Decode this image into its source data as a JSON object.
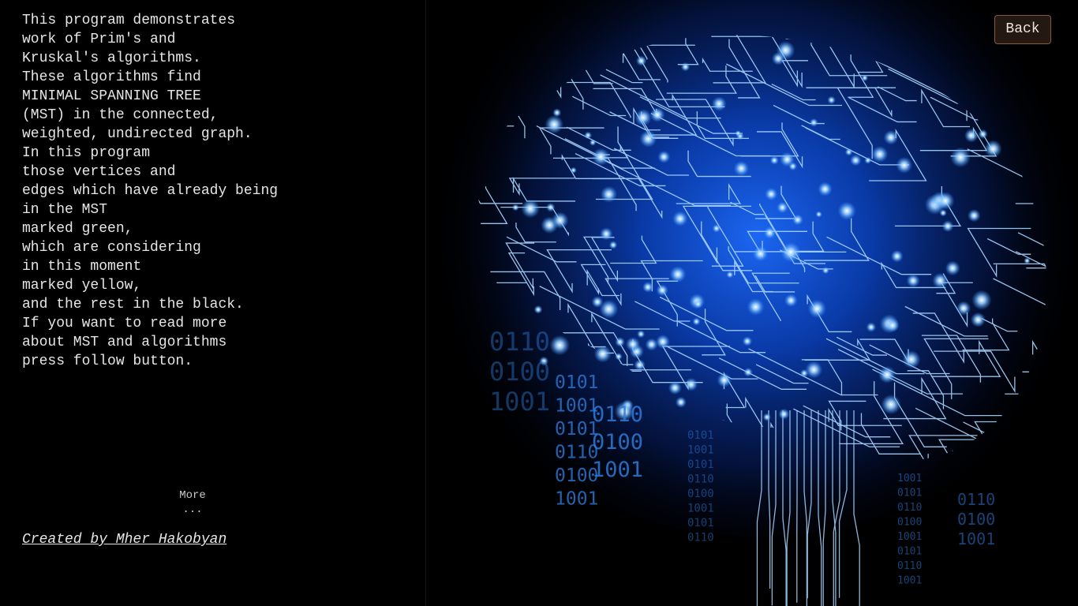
{
  "description": {
    "lines": [
      "This program demonstrates",
      "work of Prim's and",
      "Kruskal's algorithms.",
      "These algorithms find",
      "MINIMAL SPANNING TREE",
      "(MST) in the connected,",
      "weighted, undirected graph.",
      "In this program",
      "those vertices and",
      "edges which have already being",
      "in the MST",
      "marked green,",
      "which are considering",
      "in this moment",
      "marked yellow,",
      "and the rest in the black.",
      "If you want to read more",
      "about MST and algorithms",
      "press follow button."
    ]
  },
  "more": {
    "label": "More",
    "dots": "..."
  },
  "credit": "Created by Mher Hakobyan",
  "back_button": "Back",
  "illustration": {
    "icon": "circuit-brain-illustration",
    "binary_large": [
      "0110",
      "0100",
      "1001"
    ],
    "binary_medium": [
      "0101",
      "1001",
      "0101",
      "0110",
      "0100",
      "1001"
    ],
    "binary_block": [
      "0110",
      "0100",
      "1001"
    ],
    "binary_right": [
      "0110",
      "0100",
      "1001"
    ],
    "binary_small_a": [
      "0101",
      "1001",
      "0101",
      "0110",
      "0100",
      "1001",
      "0101",
      "0110"
    ],
    "binary_small_b": [
      "1001",
      "0101",
      "0110",
      "0100",
      "1001",
      "0101",
      "0110",
      "1001"
    ],
    "accent_color": "#4aa6ff",
    "glow_color": "#0a3ea8"
  }
}
